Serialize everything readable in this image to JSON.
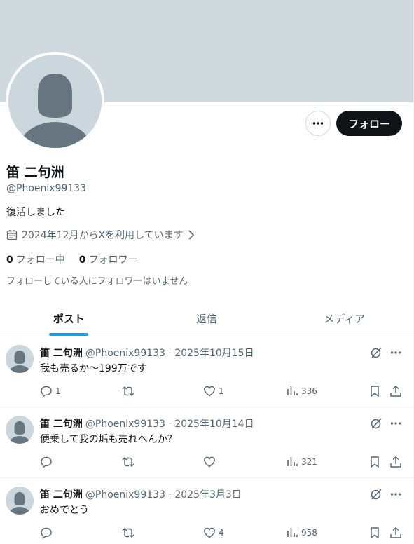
{
  "profile": {
    "name": "笛 二句洲",
    "handle": "@Phoenix99133",
    "bio": "復活しました",
    "joined": "2024年12月からXを利用しています",
    "following_count": "0",
    "following_label": "フォロー中",
    "followers_count": "0",
    "followers_label": "フォロワー",
    "no_followers_note": "フォローしている人にフォロワーはいません",
    "follow_button": "フォロー"
  },
  "tabs": [
    {
      "label": "ポスト",
      "active": true
    },
    {
      "label": "返信",
      "active": false
    },
    {
      "label": "メディア",
      "active": false
    }
  ],
  "posts": [
    {
      "name": "笛 二句洲",
      "handle": "@Phoenix99133",
      "date": "2025年10月15日",
      "text": "我も売るか〜199万です",
      "replies": "1",
      "reposts": "",
      "likes": "1",
      "views": "336"
    },
    {
      "name": "笛 二句洲",
      "handle": "@Phoenix99133",
      "date": "2025年10月14日",
      "text": "便乗して我の垢も売れへんか？",
      "replies": "",
      "reposts": "",
      "likes": "",
      "views": "321"
    },
    {
      "name": "笛 二句洲",
      "handle": "@Phoenix99133",
      "date": "2025年3月3日",
      "text": "おめでとう",
      "replies": "",
      "reposts": "",
      "likes": "4",
      "views": "958"
    }
  ],
  "colors": {
    "accent": "#1d9bf0",
    "banner": "#cfd9de",
    "text": "#0f1419",
    "muted": "#536471"
  }
}
